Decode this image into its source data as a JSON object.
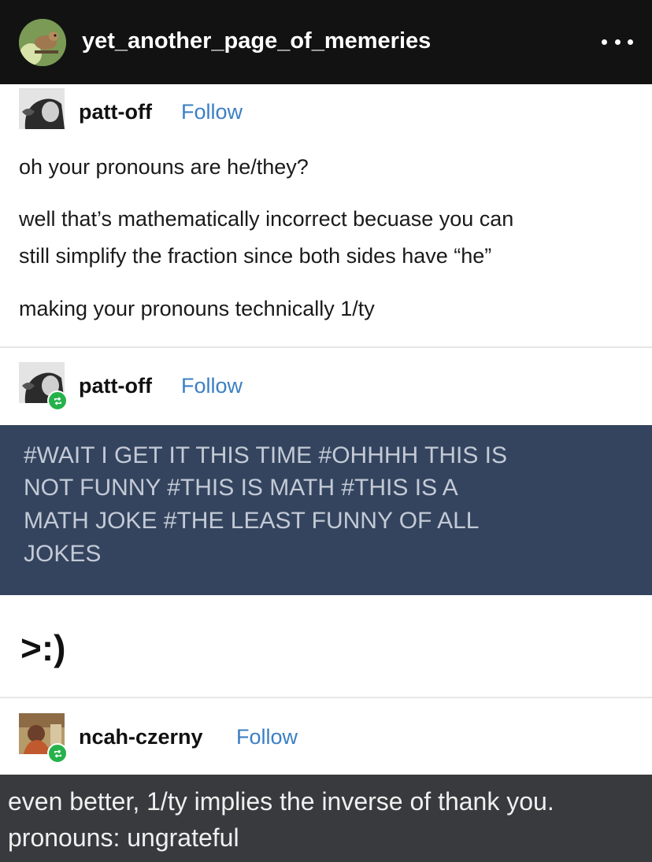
{
  "header": {
    "username": "yet_another_page_of_memeries"
  },
  "posts": [
    {
      "username": "patt-off",
      "follow_label": "Follow",
      "lines": [
        "oh your pronouns are he/they?",
        "well that’s mathematically incorrect becuase you can",
        "still simplify the fraction since both sides have “he”",
        "making your pronouns technically 1/ty"
      ]
    },
    {
      "username": "patt-off",
      "follow_label": "Follow",
      "tag_lines": [
        "#WAIT I GET IT THIS TIME  #OHHHH THIS IS",
        "NOT FUNNY  #THIS IS MATH  #THIS IS A",
        "MATH JOKE  #THE LEAST FUNNY OF ALL",
        "JOKES"
      ],
      "reply": ">:)"
    },
    {
      "username": "ncah-czerny",
      "follow_label": "Follow",
      "lines": [
        "even better, 1/ty implies the inverse of thank you.",
        "pronouns: ungrateful"
      ]
    }
  ],
  "colors": {
    "follow": "#3b7fc4",
    "tag_bg": "#34445e",
    "reblog": "#25b24a"
  }
}
